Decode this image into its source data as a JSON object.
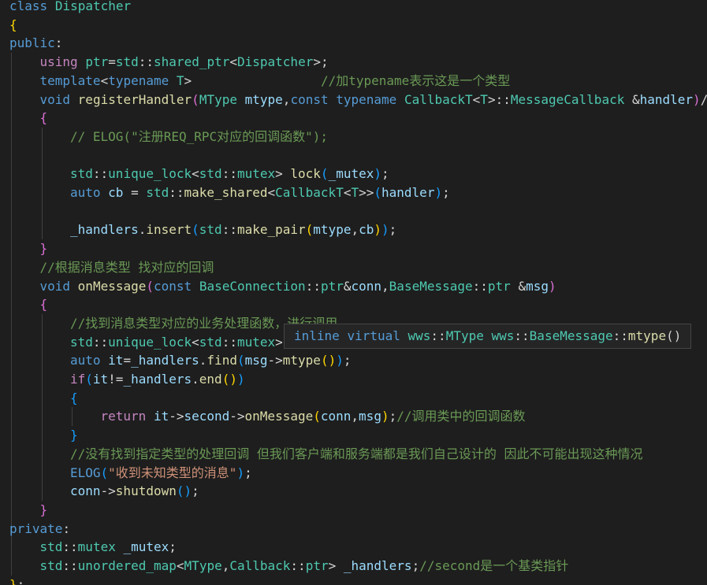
{
  "colors": {
    "background": "#1e1e1e",
    "keyword": "#569cd6",
    "control_keyword": "#c586c0",
    "type": "#4ec9b0",
    "function": "#dcdcaa",
    "variable": "#9cdcfe",
    "string": "#ce9178",
    "comment": "#6a9955",
    "bracket_level_1": "#ffd700",
    "bracket_level_2": "#da70d6",
    "bracket_level_3": "#179fff",
    "tooltip_background": "#252526",
    "tooltip_border": "#454545"
  },
  "code_lines": [
    {
      "indent": 0,
      "tokens": [
        [
          "kw",
          "class"
        ],
        [
          "op",
          " "
        ],
        [
          "type",
          "Dispatcher"
        ]
      ]
    },
    {
      "indent": 0,
      "tokens": [
        [
          "b1",
          "{"
        ]
      ]
    },
    {
      "indent": 0,
      "tokens": [
        [
          "kw",
          "public"
        ],
        [
          "op",
          ":"
        ]
      ]
    },
    {
      "indent": 1,
      "tokens": [
        [
          "ctrl",
          "using"
        ],
        [
          "op",
          " "
        ],
        [
          "type",
          "ptr"
        ],
        [
          "op",
          "="
        ],
        [
          "type",
          "std"
        ],
        [
          "op",
          "::"
        ],
        [
          "type",
          "shared_ptr"
        ],
        [
          "op",
          "<"
        ],
        [
          "type",
          "Dispatcher"
        ],
        [
          "op",
          ">;"
        ]
      ]
    },
    {
      "indent": 1,
      "tokens": [
        [
          "kw",
          "template"
        ],
        [
          "op",
          "<"
        ],
        [
          "kw",
          "typename"
        ],
        [
          "op",
          " "
        ],
        [
          "type",
          "T"
        ],
        [
          "op",
          ">"
        ],
        [
          "op",
          "                 "
        ],
        [
          "cmt",
          "//加typename表示这是一个类型"
        ]
      ]
    },
    {
      "indent": 1,
      "tokens": [
        [
          "kw",
          "void"
        ],
        [
          "op",
          " "
        ],
        [
          "fn",
          "registerHandler"
        ],
        [
          "b2",
          "("
        ],
        [
          "type",
          "MType"
        ],
        [
          "op",
          " "
        ],
        [
          "var",
          "mtype"
        ],
        [
          "op",
          ","
        ],
        [
          "kw",
          "const"
        ],
        [
          "op",
          " "
        ],
        [
          "kw",
          "typename"
        ],
        [
          "op",
          " "
        ],
        [
          "type",
          "CallbackT"
        ],
        [
          "op",
          "<"
        ],
        [
          "type",
          "T"
        ],
        [
          "op",
          ">::"
        ],
        [
          "type",
          "MessageCallback"
        ],
        [
          "op",
          " &"
        ],
        [
          "var",
          "handler"
        ],
        [
          "b2",
          ")"
        ],
        [
          "op",
          "/"
        ]
      ]
    },
    {
      "indent": 1,
      "tokens": [
        [
          "b2",
          "{"
        ]
      ]
    },
    {
      "indent": 2,
      "tokens": [
        [
          "cmt",
          "// ELOG(\"注册REQ_RPC对应的回调函数\");"
        ]
      ]
    },
    {
      "indent": 0,
      "tokens": []
    },
    {
      "indent": 2,
      "tokens": [
        [
          "type",
          "std"
        ],
        [
          "op",
          "::"
        ],
        [
          "type",
          "unique_lock"
        ],
        [
          "op",
          "<"
        ],
        [
          "type",
          "std"
        ],
        [
          "op",
          "::"
        ],
        [
          "type",
          "mutex"
        ],
        [
          "op",
          "> "
        ],
        [
          "fn",
          "lock"
        ],
        [
          "b3",
          "("
        ],
        [
          "var",
          "_mutex"
        ],
        [
          "b3",
          ")"
        ],
        [
          "op",
          ";"
        ]
      ]
    },
    {
      "indent": 2,
      "tokens": [
        [
          "kw",
          "auto"
        ],
        [
          "op",
          " "
        ],
        [
          "var",
          "cb"
        ],
        [
          "op",
          " = "
        ],
        [
          "type",
          "std"
        ],
        [
          "op",
          "::"
        ],
        [
          "fn",
          "make_shared"
        ],
        [
          "op",
          "<"
        ],
        [
          "type",
          "CallbackT"
        ],
        [
          "op",
          "<"
        ],
        [
          "type",
          "T"
        ],
        [
          "op",
          ">>"
        ],
        [
          "b3",
          "("
        ],
        [
          "var",
          "handler"
        ],
        [
          "b3",
          ")"
        ],
        [
          "op",
          ";"
        ]
      ]
    },
    {
      "indent": 0,
      "tokens": []
    },
    {
      "indent": 2,
      "tokens": [
        [
          "var",
          "_handlers"
        ],
        [
          "op",
          "."
        ],
        [
          "fn",
          "insert"
        ],
        [
          "b3",
          "("
        ],
        [
          "type",
          "std"
        ],
        [
          "op",
          "::"
        ],
        [
          "fn",
          "make_pair"
        ],
        [
          "b1",
          "("
        ],
        [
          "var",
          "mtype"
        ],
        [
          "op",
          ","
        ],
        [
          "var",
          "cb"
        ],
        [
          "b1",
          ")"
        ],
        [
          "b3",
          ")"
        ],
        [
          "op",
          ";"
        ]
      ]
    },
    {
      "indent": 1,
      "tokens": [
        [
          "b2",
          "}"
        ]
      ]
    },
    {
      "indent": 1,
      "tokens": [
        [
          "cmt",
          "//根据消息类型 找对应的回调"
        ]
      ]
    },
    {
      "indent": 1,
      "tokens": [
        [
          "kw",
          "void"
        ],
        [
          "op",
          " "
        ],
        [
          "fn",
          "onMessage"
        ],
        [
          "b2",
          "("
        ],
        [
          "kw",
          "const"
        ],
        [
          "op",
          " "
        ],
        [
          "type",
          "BaseConnection"
        ],
        [
          "op",
          "::"
        ],
        [
          "type",
          "ptr"
        ],
        [
          "op",
          "&"
        ],
        [
          "var",
          "conn"
        ],
        [
          "op",
          ","
        ],
        [
          "type",
          "BaseMessage"
        ],
        [
          "op",
          "::"
        ],
        [
          "type",
          "ptr"
        ],
        [
          "op",
          " &"
        ],
        [
          "var",
          "msg"
        ],
        [
          "b2",
          ")"
        ]
      ]
    },
    {
      "indent": 1,
      "tokens": [
        [
          "b2",
          "{"
        ]
      ]
    },
    {
      "indent": 2,
      "tokens": [
        [
          "cmt",
          "//找到消息类型对应的业务处理函数，进行调用"
        ]
      ]
    },
    {
      "indent": 2,
      "tokens": [
        [
          "type",
          "std"
        ],
        [
          "op",
          "::"
        ],
        [
          "type",
          "unique_lock"
        ],
        [
          "op",
          "<"
        ],
        [
          "type",
          "std"
        ],
        [
          "op",
          "::"
        ],
        [
          "type",
          "mutex"
        ],
        [
          "op",
          ">"
        ]
      ]
    },
    {
      "indent": 2,
      "tokens": [
        [
          "kw",
          "auto"
        ],
        [
          "op",
          " "
        ],
        [
          "var",
          "it"
        ],
        [
          "op",
          "="
        ],
        [
          "var",
          "_handlers"
        ],
        [
          "op",
          "."
        ],
        [
          "fn",
          "find"
        ],
        [
          "b3",
          "("
        ],
        [
          "var",
          "msg"
        ],
        [
          "op",
          "->"
        ],
        [
          "fn",
          "mtype"
        ],
        [
          "b1",
          "()"
        ],
        [
          "b3",
          ")"
        ],
        [
          "op",
          ";"
        ]
      ]
    },
    {
      "indent": 2,
      "tokens": [
        [
          "ctrl",
          "if"
        ],
        [
          "b3",
          "("
        ],
        [
          "var",
          "it"
        ],
        [
          "op",
          "!="
        ],
        [
          "var",
          "_handlers"
        ],
        [
          "op",
          "."
        ],
        [
          "fn",
          "end"
        ],
        [
          "b1",
          "()"
        ],
        [
          "b3",
          ")"
        ]
      ]
    },
    {
      "indent": 2,
      "tokens": [
        [
          "b3",
          "{"
        ]
      ]
    },
    {
      "indent": 3,
      "tokens": [
        [
          "ctrl",
          "return"
        ],
        [
          "op",
          " "
        ],
        [
          "var",
          "it"
        ],
        [
          "op",
          "->"
        ],
        [
          "var",
          "second"
        ],
        [
          "op",
          "->"
        ],
        [
          "fn",
          "onMessage"
        ],
        [
          "b1",
          "("
        ],
        [
          "var",
          "conn"
        ],
        [
          "op",
          ","
        ],
        [
          "var",
          "msg"
        ],
        [
          "b1",
          ")"
        ],
        [
          "op",
          ";"
        ],
        [
          "cmt",
          "//调用类中的回调函数"
        ]
      ]
    },
    {
      "indent": 2,
      "tokens": [
        [
          "b3",
          "}"
        ]
      ]
    },
    {
      "indent": 2,
      "tokens": [
        [
          "cmt",
          "//没有找到指定类型的处理回调 但我们客户端和服务端都是我们自己设计的 因此不可能出现这种情况"
        ]
      ]
    },
    {
      "indent": 2,
      "tokens": [
        [
          "macro",
          "ELOG"
        ],
        [
          "b3",
          "("
        ],
        [
          "str",
          "\"收到未知类型的消息\""
        ],
        [
          "b3",
          ")"
        ],
        [
          "op",
          ";"
        ]
      ]
    },
    {
      "indent": 2,
      "tokens": [
        [
          "var",
          "conn"
        ],
        [
          "op",
          "->"
        ],
        [
          "fn",
          "shutdown"
        ],
        [
          "b3",
          "()"
        ],
        [
          "op",
          ";"
        ]
      ]
    },
    {
      "indent": 1,
      "tokens": [
        [
          "b2",
          "}"
        ]
      ]
    },
    {
      "indent": 0,
      "tokens": [
        [
          "kw",
          "private"
        ],
        [
          "op",
          ":"
        ]
      ]
    },
    {
      "indent": 1,
      "tokens": [
        [
          "type",
          "std"
        ],
        [
          "op",
          "::"
        ],
        [
          "type",
          "mutex"
        ],
        [
          "op",
          " "
        ],
        [
          "var",
          "_mutex"
        ],
        [
          "op",
          ";"
        ]
      ]
    },
    {
      "indent": 1,
      "tokens": [
        [
          "type",
          "std"
        ],
        [
          "op",
          "::"
        ],
        [
          "type",
          "unordered_map"
        ],
        [
          "op",
          "<"
        ],
        [
          "type",
          "MType"
        ],
        [
          "op",
          ","
        ],
        [
          "type",
          "Callback"
        ],
        [
          "op",
          "::"
        ],
        [
          "type",
          "ptr"
        ],
        [
          "op",
          "> "
        ],
        [
          "var",
          "_handlers"
        ],
        [
          "op",
          ";"
        ],
        [
          "cmt",
          "//second是一个基类指针"
        ]
      ]
    },
    {
      "indent": 0,
      "tokens": [
        [
          "b1",
          "}"
        ],
        [
          "op",
          ";"
        ]
      ]
    }
  ],
  "hover": {
    "tokens": [
      [
        "kw",
        "inline"
      ],
      [
        "op",
        " "
      ],
      [
        "kw",
        "virtual"
      ],
      [
        "op",
        " "
      ],
      [
        "type",
        "wws"
      ],
      [
        "op",
        "::"
      ],
      [
        "type",
        "MType"
      ],
      [
        "op",
        " "
      ],
      [
        "type",
        "wws"
      ],
      [
        "op",
        "::"
      ],
      [
        "type",
        "BaseMessage"
      ],
      [
        "op",
        "::"
      ],
      [
        "fn",
        "mtype"
      ],
      [
        "op",
        "()"
      ]
    ]
  }
}
